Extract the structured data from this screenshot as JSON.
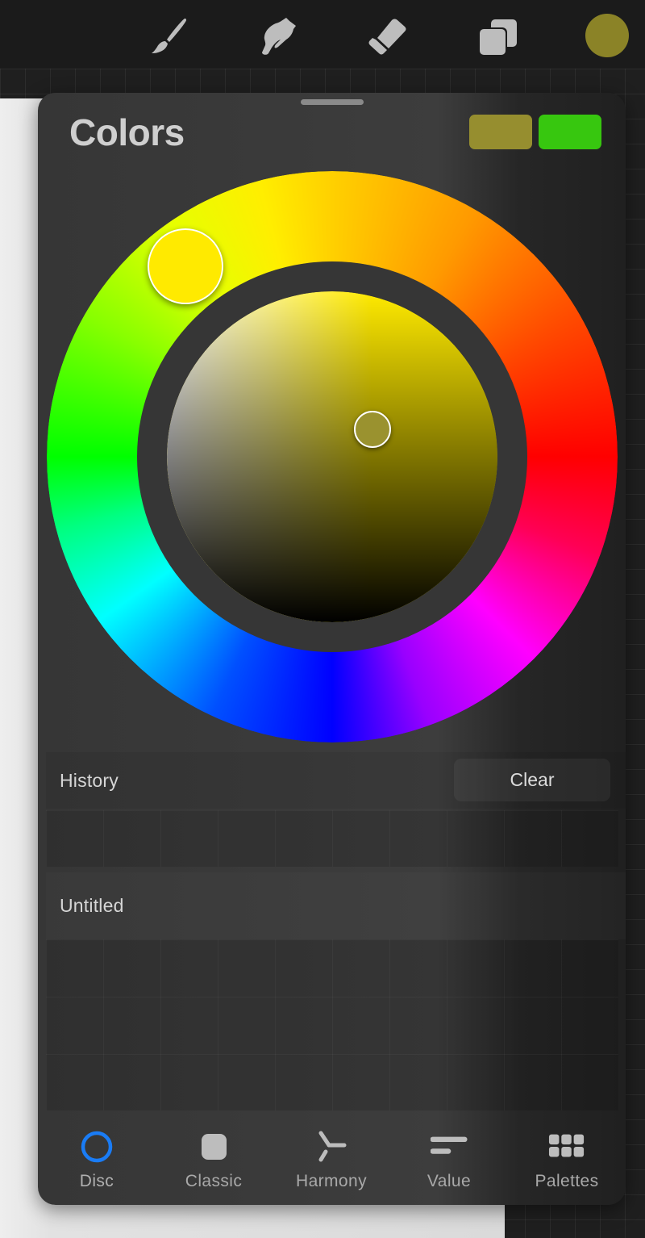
{
  "toolbar": {
    "tools": [
      {
        "name": "brush",
        "icon": "brush-icon"
      },
      {
        "name": "smudge",
        "icon": "smudge-icon"
      },
      {
        "name": "eraser",
        "icon": "eraser-icon"
      },
      {
        "name": "layers",
        "icon": "layers-icon"
      }
    ],
    "current_color": "#8b8327",
    "icon_color": "#bdbdbd"
  },
  "colors_panel": {
    "title": "Colors",
    "primary_swatch": "#968e2f",
    "secondary_swatch": "#37c70f",
    "disc": {
      "hue_degrees": 55,
      "saturation": 0.72,
      "brightness": 0.62,
      "selected_color": "#9a922f",
      "hue_handle_color": "#ffea00"
    },
    "history": {
      "label": "History",
      "clear_label": "Clear",
      "swatches": []
    },
    "palette": {
      "name": "Untitled",
      "swatches": []
    },
    "tabs": [
      {
        "label": "Disc",
        "icon": "disc-icon",
        "active": true
      },
      {
        "label": "Classic",
        "icon": "classic-square-icon",
        "active": false
      },
      {
        "label": "Harmony",
        "icon": "harmony-icon",
        "active": false
      },
      {
        "label": "Value",
        "icon": "value-sliders-icon",
        "active": false
      },
      {
        "label": "Palettes",
        "icon": "palettes-grid-icon",
        "active": false
      }
    ],
    "accent_color": "#1a7cf5"
  }
}
